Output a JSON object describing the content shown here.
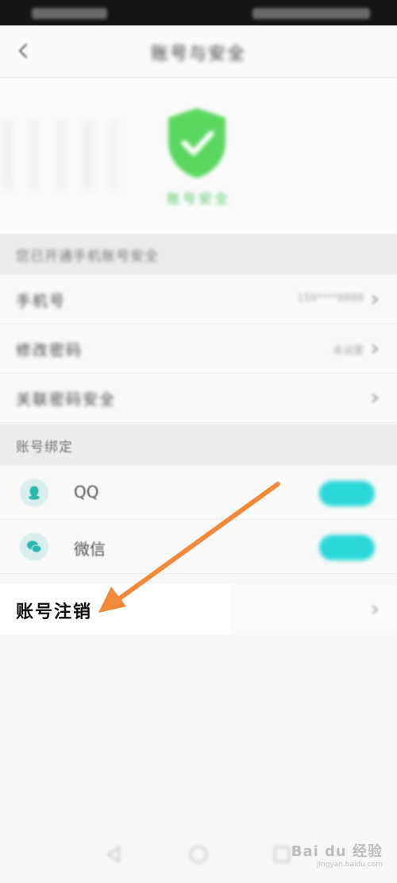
{
  "navbar": {
    "title": "账号与安全"
  },
  "hero": {
    "status_text": "账号安全"
  },
  "security_section": {
    "header": "您已开通手机账号安全"
  },
  "security_items": [
    {
      "label": "手机号",
      "value": "159****8888"
    },
    {
      "label": "修改密码",
      "value": "未设置"
    },
    {
      "label": "关联密码安全",
      "value": ""
    }
  ],
  "binding_section": {
    "header": "账号绑定"
  },
  "binding_items": [
    {
      "label": "QQ",
      "toggle": "绑定"
    },
    {
      "label": "微信",
      "toggle": "绑定"
    }
  ],
  "cancel": {
    "label": "账号注销"
  },
  "watermark": {
    "brand": "Bai du 经验",
    "url": "jingyan.baidu.com"
  },
  "colors": {
    "shield_green": "#5bd75f",
    "toggle_cyan": "#2ad7d9",
    "arrow_orange": "#f08a3a"
  }
}
